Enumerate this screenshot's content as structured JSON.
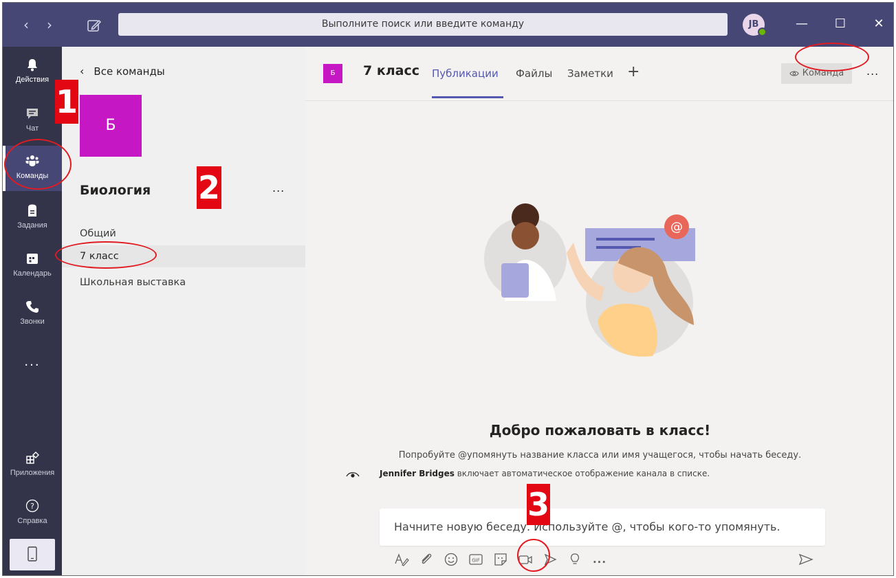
{
  "titlebar": {
    "search_placeholder": "Выполните поиск или введите команду",
    "user_initials": "JB"
  },
  "rail": {
    "items": [
      {
        "label": "Действия",
        "icon": "bell-icon"
      },
      {
        "label": "Чат",
        "icon": "chat-icon"
      },
      {
        "label": "Команды",
        "icon": "teams-icon",
        "active": true
      },
      {
        "label": "Задания",
        "icon": "assignments-icon"
      },
      {
        "label": "Календарь",
        "icon": "calendar-icon"
      },
      {
        "label": "Звонки",
        "icon": "phone-icon"
      }
    ],
    "more": "...",
    "apps_label": "Приложения",
    "help_label": "Справка"
  },
  "team_panel": {
    "back_label": "Все команды",
    "team_initial": "Б",
    "team_name": "Биология",
    "more": "...",
    "channels": [
      {
        "label": "Общий",
        "active": false
      },
      {
        "label": "7 класс",
        "active": true
      },
      {
        "label": "Школьная выставка",
        "active": false
      }
    ]
  },
  "header": {
    "team_initial": "Б",
    "title": "7 класс",
    "tabs": [
      {
        "label": "Публикации",
        "active": true
      },
      {
        "label": "Файлы",
        "active": false
      },
      {
        "label": "Заметки",
        "active": false
      }
    ],
    "add_tab": "+",
    "team_button": "Команда",
    "more": "..."
  },
  "welcome": {
    "title": "Добро пожаловать в класс!",
    "subtitle": "Попробуйте @упомянуть название класса или имя учащегося, чтобы начать беседу.",
    "info_name": "Jennifer Bridges",
    "info_text": " включает автоматическое отображение канала в списке."
  },
  "compose": {
    "placeholder": "Начните новую беседу. Используйте @, чтобы кого-то упомянуть.",
    "toolbar": [
      "format-icon",
      "attach-icon",
      "emoji-icon",
      "gif-icon",
      "sticker-icon",
      "meet-now-icon",
      "praise-icon",
      "idea-icon",
      "more-icon"
    ],
    "more": "..."
  },
  "annotations": {
    "marker_1": "1",
    "marker_2": "2",
    "marker_3": "3"
  },
  "colors": {
    "titlebar": "#464775",
    "rail": "#33344a",
    "accent": "#5558af",
    "team_tile": "#c617c4",
    "marker": "#e30613"
  }
}
